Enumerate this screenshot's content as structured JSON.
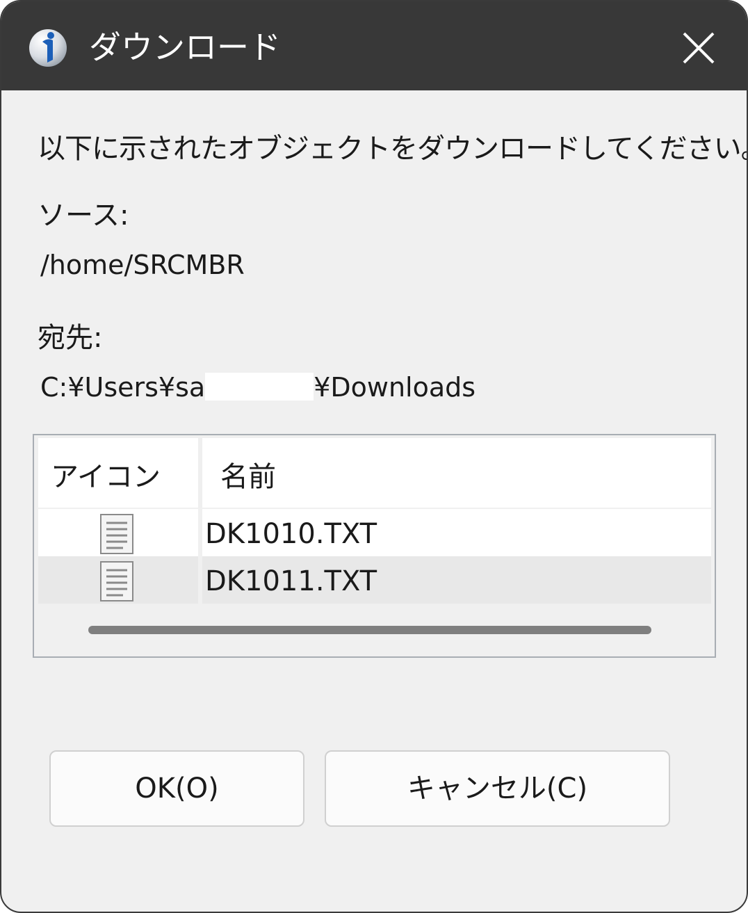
{
  "window": {
    "title": "ダウンロード",
    "close_symbol": "✕",
    "app_icon": "info-icon",
    "titlebar_color": "#383838",
    "body_color": "#f0f0f0"
  },
  "instruction": "以下に示されたオブジェクトをダウンロードしてください。",
  "source": {
    "label": "ソース:",
    "value": "/home/SRCMBR"
  },
  "destination": {
    "label": "宛先:",
    "value_prefix": "C:¥Users¥sa",
    "value_suffix": "¥Downloads"
  },
  "file_list": {
    "columns": [
      "アイコン",
      "名前"
    ],
    "rows": [
      {
        "icon": "text-file-icon",
        "name": "DK1010.TXT",
        "selected": false
      },
      {
        "icon": "text-file-icon",
        "name": "DK1011.TXT",
        "selected": true
      }
    ]
  },
  "buttons": {
    "ok": "OK(O)",
    "cancel": "キャンセル(C)"
  }
}
